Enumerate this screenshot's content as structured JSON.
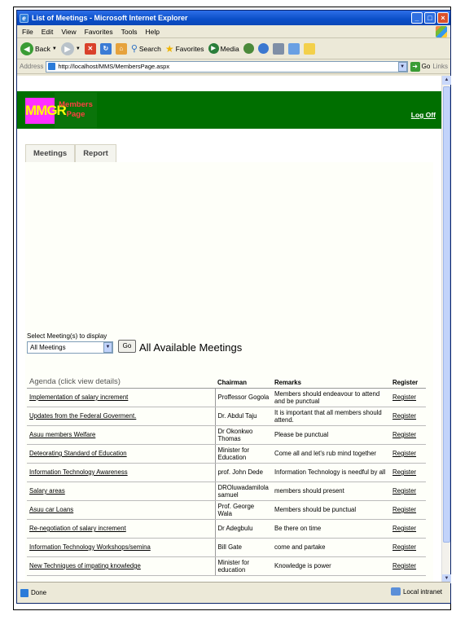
{
  "window": {
    "title": "List of Meetings - Microsoft Internet Explorer"
  },
  "menu": [
    "File",
    "Edit",
    "View",
    "Favorites",
    "Tools",
    "Help"
  ],
  "toolbar": {
    "back": "Back",
    "search": "Search",
    "favorites": "Favorites",
    "media": "Media"
  },
  "address": {
    "label": "Address",
    "url": "http://localhost/MMS/MembersPage.aspx",
    "go": "Go",
    "links": "Links"
  },
  "page": {
    "logo": "MMGR",
    "section_line1": "Members",
    "section_line2": "Page",
    "logoff": "Log Off",
    "tabs": [
      "Meetings",
      "Report"
    ],
    "select_label": "Select Meeting(s) to display",
    "select_value": "All Meetings",
    "go_button": "Go",
    "heading": "All Available Meetings"
  },
  "table": {
    "headers": {
      "agenda": "Agenda (click view details)",
      "chairman": "Chairman",
      "remarks": "Remarks",
      "register": "Register"
    },
    "rows": [
      {
        "agenda": "Implementation of salary increment",
        "chairman": "Proffessor Gogola",
        "remarks": "Members should endeavour to attend and be punctual",
        "register": "Register"
      },
      {
        "agenda": "Updates from the Federal Goverment.",
        "chairman": "Dr. Abdul Taju",
        "remarks": "It is important that all members should attend.",
        "register": "Register"
      },
      {
        "agenda": "Asuu members Welfare",
        "chairman": "Dr Okonkwo Thomas",
        "remarks": "Please be punctual",
        "register": "Register"
      },
      {
        "agenda": "Deteorating Standard of Education",
        "chairman": "Minister for Education",
        "remarks": "Come all and let's rub mind together",
        "register": "Register"
      },
      {
        "agenda": "Information Technology Awareness",
        "chairman": "prof. John Dede",
        "remarks": "Information Technology is needful by all",
        "register": "Register"
      },
      {
        "agenda": "Salary areas",
        "chairman": "DROluwadamilola samuel",
        "remarks": "members should present",
        "register": "Register"
      },
      {
        "agenda": "Asuu car Loans",
        "chairman": "Prof. George Wala",
        "remarks": "Members should be punctual",
        "register": "Register"
      },
      {
        "agenda": "Re-negotiation of salary increment",
        "chairman": "Dr Adegbulu",
        "remarks": "Be there on time",
        "register": "Register"
      },
      {
        "agenda": "Information Technology Workshops/semina",
        "chairman": "Bill Gate",
        "remarks": "come and partake",
        "register": "Register"
      },
      {
        "agenda": "New Techniques of impating knowledge",
        "chairman": "Minister for education",
        "remarks": "Knowledge is power",
        "register": "Register"
      }
    ],
    "pager": [
      "<",
      ">"
    ]
  },
  "status": {
    "left": "Done",
    "zone": "Local intranet"
  }
}
